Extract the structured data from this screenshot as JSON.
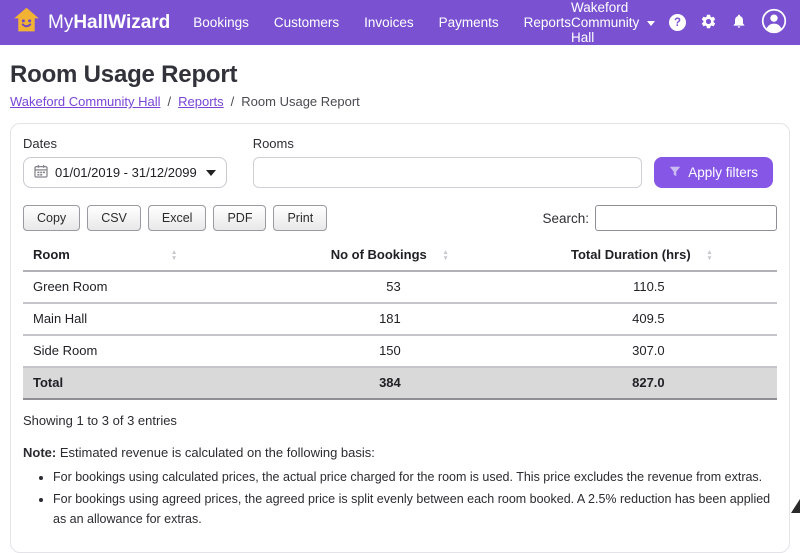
{
  "brand": {
    "name_light": "My",
    "name_bold": "HallWizard"
  },
  "nav": {
    "items": [
      {
        "label": "Bookings"
      },
      {
        "label": "Customers"
      },
      {
        "label": "Invoices"
      },
      {
        "label": "Payments"
      },
      {
        "label": "Reports"
      }
    ]
  },
  "account": {
    "venue": "Wakeford Community Hall",
    "help_glyph": "?"
  },
  "page": {
    "title": "Room Usage Report",
    "breadcrumb_separator": "/",
    "breadcrumb": [
      {
        "label": "Wakeford Community Hall"
      },
      {
        "label": "Reports"
      },
      {
        "label": "Room Usage Report"
      }
    ]
  },
  "filters": {
    "dates_label": "Dates",
    "dates_value": "01/01/2019 - 31/12/2099",
    "rooms_label": "Rooms",
    "rooms_value": "",
    "apply_label": "Apply filters"
  },
  "toolbar": {
    "buttons": [
      "Copy",
      "CSV",
      "Excel",
      "PDF",
      "Print"
    ],
    "search_label": "Search:",
    "search_value": ""
  },
  "table": {
    "columns": [
      "Room",
      "No of Bookings",
      "Total Duration (hrs)"
    ],
    "rows": [
      [
        "Green Room",
        "53",
        "110.5"
      ],
      [
        "Main Hall",
        "181",
        "409.5"
      ],
      [
        "Side Room",
        "150",
        "307.0"
      ]
    ],
    "total": [
      "Total",
      "384",
      "827.0"
    ],
    "info": "Showing 1 to 3 of 3 entries"
  },
  "note": {
    "label": "Note:",
    "text": " Estimated revenue is calculated on the following basis:",
    "bullets": [
      "For bookings using calculated prices, the actual price charged for the room is used. This price excludes the revenue from extras.",
      "For bookings using agreed prices, the agreed price is split evenly between each room booked. A 2.5% reduction has been applied as an allowance for extras."
    ]
  },
  "colors": {
    "header_bg": "#7a52d1",
    "accent": "#8656e6",
    "link": "#7a45d6",
    "total_row_bg": "#d9d9d9",
    "logo_house": "#f2b234"
  }
}
